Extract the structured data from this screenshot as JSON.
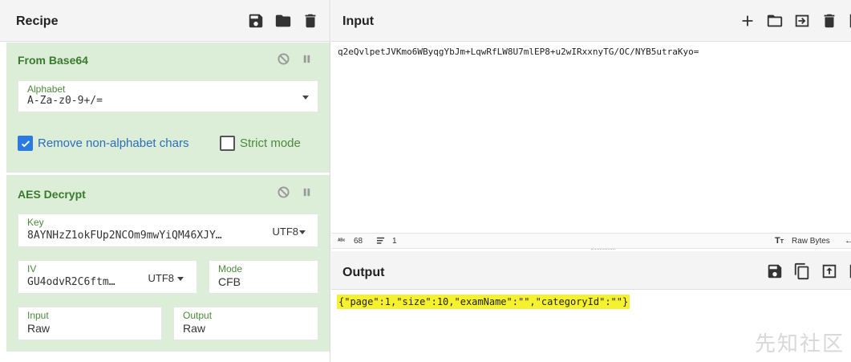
{
  "recipe": {
    "title": "Recipe",
    "icons": [
      "save-icon",
      "folder-icon",
      "trash-icon"
    ]
  },
  "from_base64": {
    "title": "From Base64",
    "alphabet_label": "Alphabet",
    "alphabet_value": "A-Za-z0-9+/=",
    "remove_nonalpha_label": "Remove non-alphabet chars",
    "remove_nonalpha_checked": true,
    "strict_mode_label": "Strict mode",
    "strict_mode_checked": false
  },
  "aes_decrypt": {
    "title": "AES Decrypt",
    "key_label": "Key",
    "key_value": "8AYNHzZ1okFUp2NCOm9mwYiQM46XJY…",
    "key_encoding": "UTF8",
    "iv_label": "IV",
    "iv_value": "GU4odvR2C6ftm…",
    "iv_encoding": "UTF8",
    "mode_label": "Mode",
    "mode_value": "CFB",
    "input_label": "Input",
    "input_value": "Raw",
    "output_label": "Output",
    "output_value": "Raw"
  },
  "input": {
    "title": "Input",
    "text": "q2eQvlpetJVKmo6WByqgYbJm+LqwRfLW8U7mlEP8+u2wIRxxnyTG/OC/NYB5utraKyo=",
    "status_length": "68",
    "status_lines": "1",
    "status_length_icon": "abc-icon",
    "raw_bytes_label": "Raw Bytes"
  },
  "output": {
    "title": "Output",
    "text": "{\"page\":1,\"size\":10,\"examName\":\"\",\"categoryId\":\"\"}"
  },
  "watermark": "先知社区",
  "colors": {
    "op_bg": "#dcedd8",
    "op_title": "#3a7a2e",
    "label_green": "#4b8a3c",
    "checkbox_blue": "#2a7ae2",
    "highlight": "#f6f12e"
  }
}
